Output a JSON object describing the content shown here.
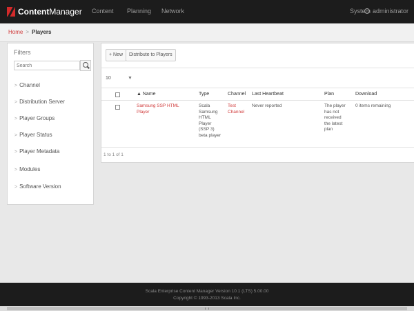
{
  "app": {
    "logo_bold": "Content",
    "logo_thin": "Manager"
  },
  "nav": {
    "content": "Content",
    "planning": "Planning",
    "network": "Network",
    "system": "System",
    "user": "administrator"
  },
  "breadcrumb": {
    "home": "Home",
    "sep": ">",
    "current": "Players"
  },
  "filters": {
    "title": "Filters",
    "search_placeholder": "Search",
    "items": [
      "Channel",
      "Distribution Server",
      "Player Groups",
      "Player Status",
      "Player Metadata",
      "Modules",
      "Software Version"
    ]
  },
  "toolbar": {
    "new_label": "+ New",
    "distribute_label": "Distribute to Players"
  },
  "pagesize": {
    "value": "10"
  },
  "table": {
    "headers": {
      "name": "▲ Name",
      "type": "Type",
      "channel": "Channel",
      "heartbeat": "Last Heartbeat",
      "plan": "Plan",
      "download": "Download"
    },
    "rows": [
      {
        "name_lines": [
          "Samsung SSP HTML",
          "Player"
        ],
        "type_lines": [
          "Scala",
          "Samsung",
          "HTML",
          "Player",
          "(SSP 3)",
          "beta player"
        ],
        "channel_lines": [
          "Test",
          "Channel"
        ],
        "heartbeat": "Never reported",
        "plan_lines": [
          "The player",
          "has not",
          "received",
          "the latest",
          "plan"
        ],
        "download": "0 items remaining"
      }
    ],
    "count": "1 to 1 of 1"
  },
  "footer": {
    "line1": "Scala Enterprise Content Manager Version 10.1 (LTS) 5.00.00",
    "line2": "Copyright © 1993-2013 Scala Inc."
  },
  "colors": {
    "topbar": "#1c1c1c",
    "accent": "#d03a3a",
    "background": "#e8e8e8"
  }
}
